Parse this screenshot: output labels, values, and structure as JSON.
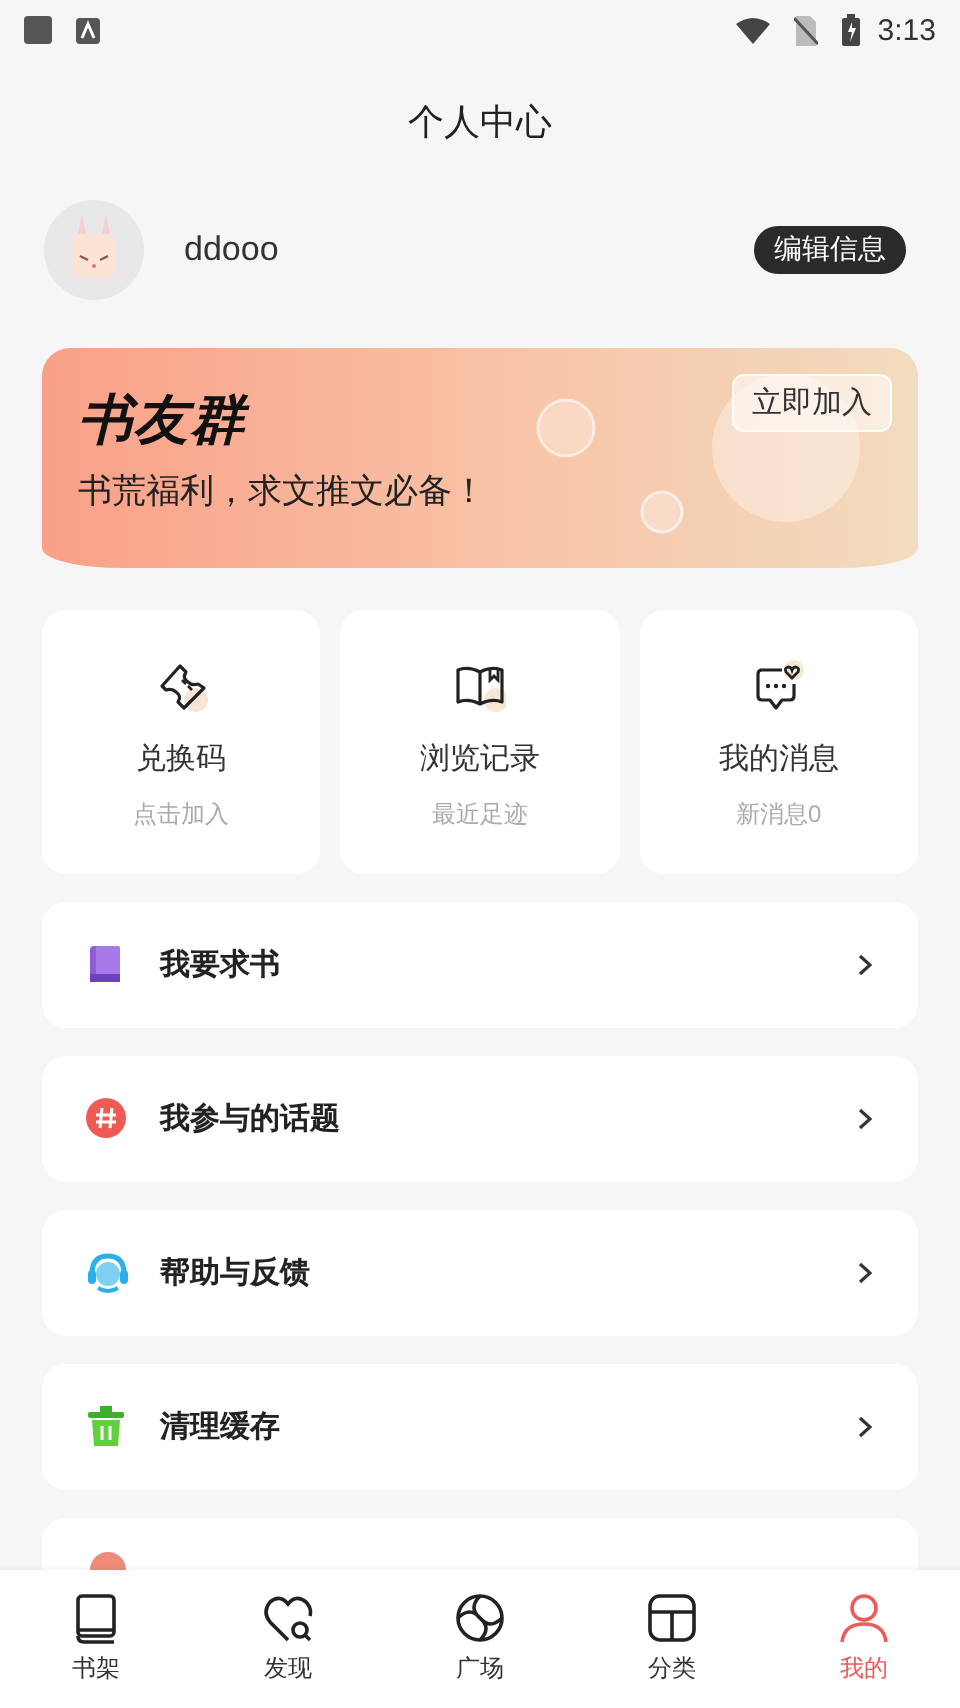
{
  "status_bar": {
    "time": "3:13"
  },
  "header": {
    "title": "个人中心"
  },
  "profile": {
    "username": "ddooo",
    "edit_button": "编辑信息"
  },
  "banner": {
    "title": "书友群",
    "subtitle": "书荒福利，求文推文必备！",
    "button": "立即加入"
  },
  "shortcuts": [
    {
      "label": "兑换码",
      "hint": "点击加入"
    },
    {
      "label": "浏览记录",
      "hint": "最近足迹"
    },
    {
      "label": "我的消息",
      "hint": "新消息0"
    }
  ],
  "menu": [
    {
      "label": "我要求书"
    },
    {
      "label": "我参与的话题"
    },
    {
      "label": "帮助与反馈"
    },
    {
      "label": "清理缓存"
    }
  ],
  "bottom_nav": [
    {
      "label": "书架",
      "selected": false
    },
    {
      "label": "发现",
      "selected": false
    },
    {
      "label": "广场",
      "selected": false
    },
    {
      "label": "分类",
      "selected": false
    },
    {
      "label": "我的",
      "selected": true
    }
  ]
}
